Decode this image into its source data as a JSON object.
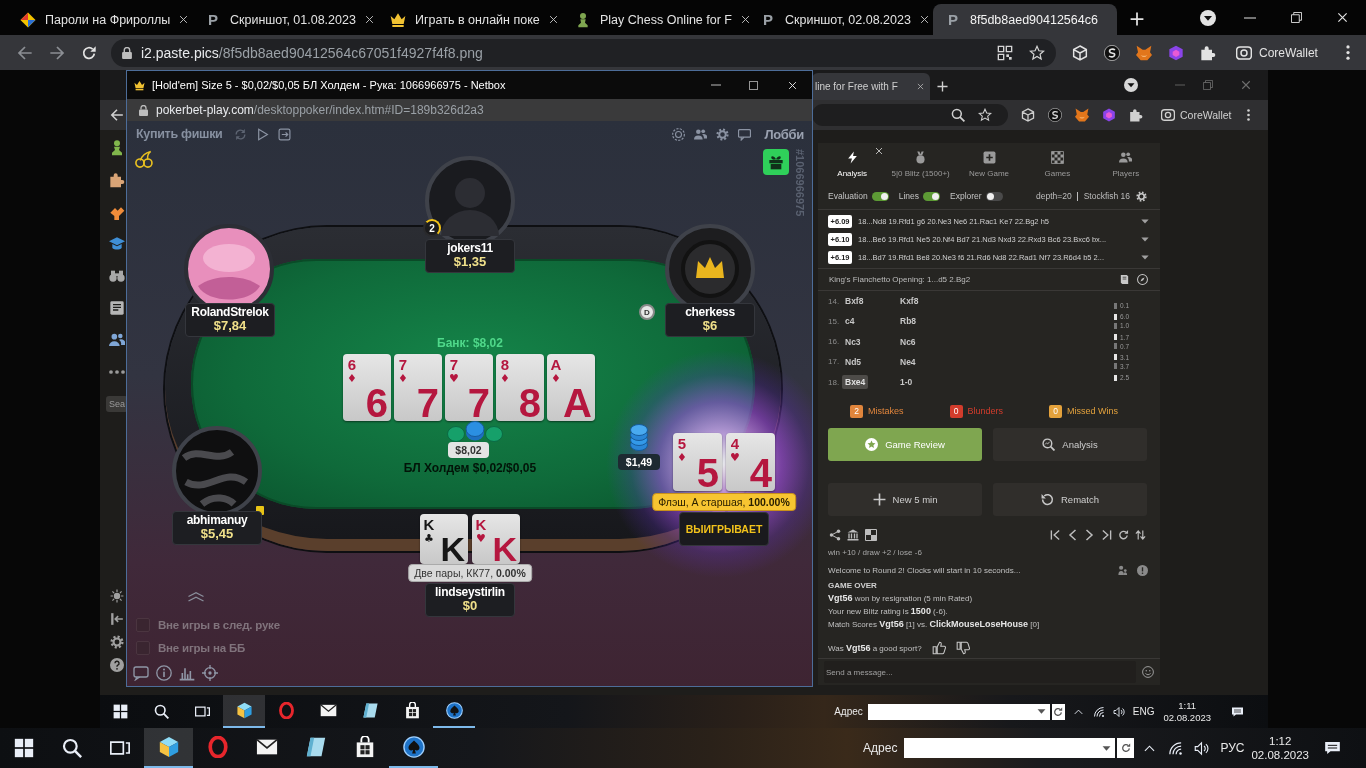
{
  "browser": {
    "tabs": [
      {
        "title": "Пароли на Фрироллы",
        "selected": false
      },
      {
        "title": "Скриншот, 01.08.2023",
        "letter": "P",
        "selected": false
      },
      {
        "title": "Играть в онлайн поке",
        "selected": false
      },
      {
        "title": "Play Chess Online for F",
        "selected": false
      },
      {
        "title": "Скриншот, 02.08.2023",
        "letter": "P",
        "selected": false
      },
      {
        "title": "8f5db8aed90412564c6",
        "letter": "P",
        "selected": true
      }
    ],
    "url": {
      "host": "i2.paste.pics",
      "path": "/8f5db8aed90412564c67051f4927f4f8.png"
    },
    "profile": "CoreWallet"
  },
  "inner_browser": {
    "tab": {
      "title": "line for Free with F"
    },
    "profile": "CoreWallet",
    "sidebar_search": {
      "placeholder": "Sea"
    }
  },
  "poker_window": {
    "title": "[Hold'em] Size 5 - $0,02/$0,05 БЛ Холдем - Рука: 1066966975 - Netbox",
    "url": {
      "host": "pokerbet-play.com",
      "path": "/desktoppoker/index.htm#ID=189b326d2a3"
    },
    "buy_chips": "Купить фишки",
    "lobby": "Лобби",
    "hand_id": "#1066966975",
    "pot": "Банк: $8,02",
    "board": [
      {
        "corner": "6",
        "suit": "♦",
        "rank": "6",
        "color": "#b5173f"
      },
      {
        "corner": "7",
        "suit": "♦",
        "rank": "7",
        "color": "#b5173f"
      },
      {
        "corner": "7",
        "suit": "♥",
        "rank": "7",
        "color": "#b5173f"
      },
      {
        "corner": "8",
        "suit": "♦",
        "rank": "8",
        "color": "#b5173f"
      },
      {
        "corner": "A",
        "suit": "♦",
        "rank": "A",
        "color": "#b5173f"
      }
    ],
    "pot_chips": "$8,02",
    "table_label": "БЛ Холдем $0,02/$0,05",
    "seats": [
      {
        "name": "jokers11",
        "stack": "$1,35",
        "avatar": {
          "kind": "silhouette"
        },
        "badge": "2"
      },
      {
        "name": "RolandStrelok",
        "stack": "$7,84",
        "avatar": {
          "kind": "picture"
        }
      },
      {
        "name": "cherkess",
        "stack": "$6",
        "avatar": {
          "kind": "emblem"
        },
        "dealer": "D"
      },
      {
        "name": "abhimanuy",
        "stack": "$5,45",
        "avatar": {
          "kind": "pattern"
        },
        "level_badge": true
      },
      {
        "name": "lindseystirlin",
        "stack": "$0",
        "cards": [
          {
            "corner": "K",
            "suit": "♣",
            "rank": "K",
            "color": "#161616"
          },
          {
            "corner": "K",
            "suit": "♥",
            "rank": "K",
            "color": "#b5173f"
          }
        ],
        "hand": "Две пары, КК77, **0.00%**",
        "winner": false
      },
      {
        "cards": [
          {
            "corner": "5",
            "suit": "♦",
            "rank": "5",
            "color": "#b5173f"
          },
          {
            "corner": "4",
            "suit": "♥",
            "rank": "4",
            "color": "#b5173f"
          }
        ],
        "hand": "Флэш, A старшая, **100.00%**",
        "winner": true,
        "result": "ВЫИГРЫВАЕТ",
        "bet": "$1,49"
      }
    ],
    "options": [
      {
        "label": "Вне игры в след. руке",
        "checked": false
      },
      {
        "label": "Вне игры на ББ",
        "checked": false
      }
    ]
  },
  "chess_panel": {
    "tabs": [
      {
        "label": "Analysis",
        "selected": true
      },
      {
        "label": "5|0 Blitz (1500+)",
        "selected": false
      },
      {
        "label": "New Game",
        "selected": false
      },
      {
        "label": "Games",
        "selected": false
      },
      {
        "label": "Players",
        "selected": false
      }
    ],
    "toggles": [
      {
        "label": "Evaluation",
        "on": true
      },
      {
        "label": "Lines",
        "on": true
      },
      {
        "label": "Explorer",
        "on": false
      }
    ],
    "depth": "depth=20",
    "engine": "Stockfish 16",
    "lines": [
      {
        "score": "+6.09",
        "moves": "18...Nd8 19.Rfd1 g6 20.Ne3 Ne6 21.Rac1 Ke7 22.Bg2 h5"
      },
      {
        "score": "+6.10",
        "moves": "18...Be6 19.Rfd1 Ne5 20.Nf4 Bd7 21.Nd3 Nxd3 22.Rxd3 Bc6 23.Bxc6 bx..."
      },
      {
        "score": "+6.19",
        "moves": "18...Bd7 19.Rfd1 Be8 20.Ne3 f6 21.Rd6 Nd8 22.Rad1 Nf7 23.R6d4 b5 2..."
      }
    ],
    "opening": "King's Fianchetto Opening: 1...d5 2.Bg2",
    "moves": [
      {
        "number": "14.",
        "white": {
          "move": "Bxf8",
          "selected": false
        },
        "black": {
          "move": "Kxf8",
          "selected": false,
          "time": "0.1"
        }
      },
      {
        "number": "15.",
        "white": {
          "move": "c4",
          "selected": false,
          "time": "6.0"
        },
        "black": {
          "move": "Rb8",
          "selected": false,
          "time": "1.0"
        }
      },
      {
        "number": "16.",
        "white": {
          "move": "Nc3",
          "selected": false,
          "time": "1.7"
        },
        "black": {
          "move": "Nc6",
          "selected": false,
          "time": "0.7"
        }
      },
      {
        "number": "17.",
        "white": {
          "move": "Nd5",
          "selected": false,
          "time": "3.1"
        },
        "black": {
          "move": "Ne4",
          "selected": false,
          "time": "3.7"
        }
      },
      {
        "number": "18.",
        "white": {
          "move": "Bxe4",
          "selected": true,
          "time": "2.5"
        },
        "result": "1-0"
      }
    ],
    "stats": [
      {
        "count": "2",
        "label": "Mistakes",
        "color": "#e0853c"
      },
      {
        "count": "0",
        "label": "Blunders",
        "color": "#d23c2c"
      },
      {
        "count": "0",
        "label": "Missed Wins",
        "color": "#e4a23c"
      }
    ],
    "buttons": [
      {
        "label": "Game Review",
        "kind": "primary"
      },
      {
        "label": "Analysis",
        "kind": "secondary"
      },
      {
        "label": "New 5 min",
        "kind": "secondary"
      },
      {
        "label": "Rematch",
        "kind": "secondary"
      }
    ],
    "chat": {
      "rating_note": "win +10 / draw +2 / lose -6",
      "welcome": "Welcome to Round 2! Clocks will start in 10 seconds...",
      "game_over": "GAME OVER",
      "lines": [
        "**Vgt56** won by resignation (5 min Rated)",
        "Your new Blitz rating is **1500** (-6).",
        "Match Scores **Vgt56** [1] vs. **ClickMouseLoseHouse** [0]"
      ],
      "sport_question": "Was **Vgt56** a good sport?",
      "input": {
        "placeholder": "Send a message..."
      }
    }
  },
  "inner_taskbar": {
    "apps": [
      {
        "running": true,
        "selected": true
      },
      {
        "running": false,
        "selected": false
      },
      {
        "running": false,
        "selected": false
      },
      {
        "running": false,
        "selected": false
      },
      {
        "running": false,
        "selected": false
      },
      {
        "running": true,
        "selected": false
      }
    ],
    "address_label": "Адрес",
    "language": "ENG",
    "time": "1:11",
    "date": "02.08.2023"
  },
  "taskbar": {
    "apps": [
      {
        "running": true,
        "selected": true
      },
      {
        "running": false,
        "selected": false
      },
      {
        "running": false,
        "selected": false
      },
      {
        "running": false,
        "selected": false
      },
      {
        "running": false,
        "selected": false
      },
      {
        "running": true,
        "selected": false
      }
    ],
    "address_label": "Адрес",
    "language": "РУС",
    "time": "1:12",
    "date": "02.08.2023"
  }
}
